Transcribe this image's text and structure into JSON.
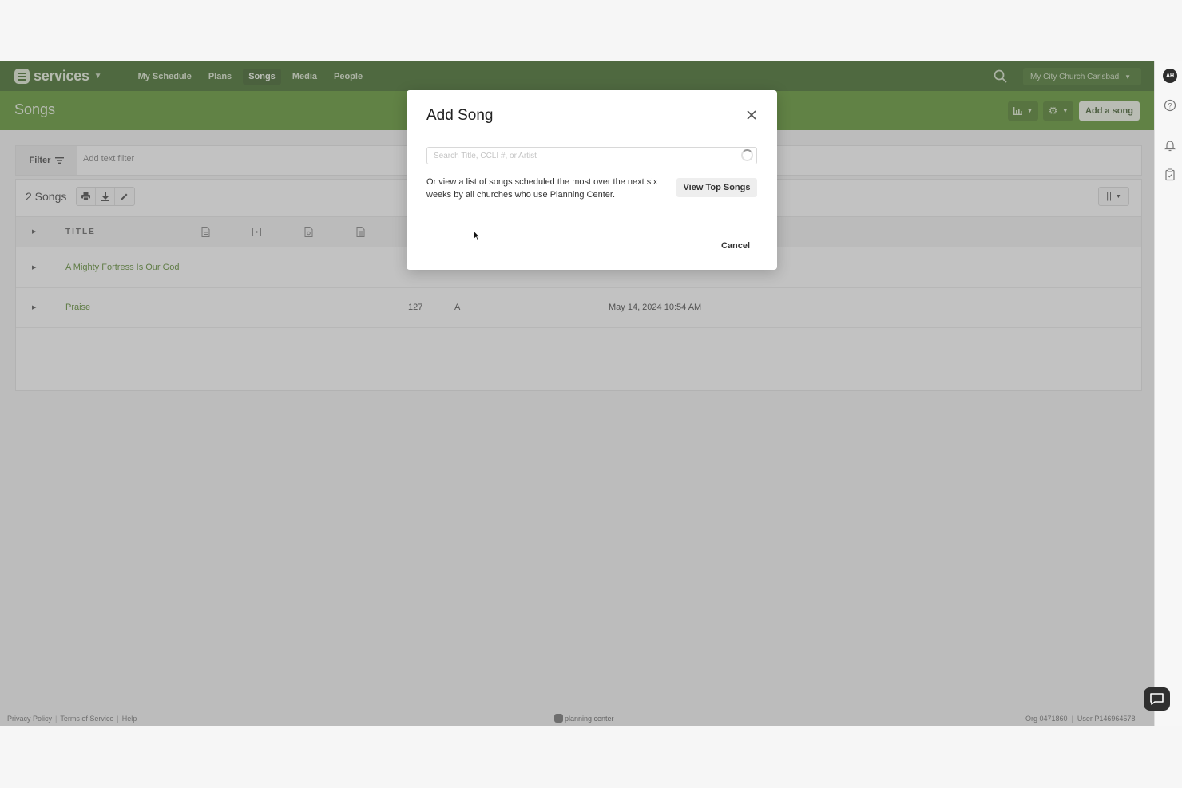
{
  "nav": {
    "brand": "services",
    "links": [
      "My Schedule",
      "Plans",
      "Songs",
      "Media",
      "People"
    ],
    "active_link": "Songs",
    "org": "My City Church Carlsbad"
  },
  "user": {
    "initials": "AH"
  },
  "page": {
    "title": "Songs",
    "add_button": "Add a song"
  },
  "filter": {
    "label": "Filter",
    "placeholder": "Add text filter"
  },
  "table": {
    "count": "2 Songs",
    "header_title": "TITLE",
    "rows": [
      {
        "title": "A Mighty Fortress Is Our God",
        "ccli": "",
        "key": "",
        "updated": ""
      },
      {
        "title": "Praise",
        "ccli": "127",
        "key": "A",
        "updated": "May 14, 2024 10:54 AM"
      }
    ]
  },
  "modal": {
    "title": "Add Song",
    "search_placeholder": "Search Title, CCLI #, or Artist",
    "description": "Or view a list of songs scheduled the most over the next six weeks by all churches who use Planning Center.",
    "top_songs_button": "View Top Songs",
    "cancel_button": "Cancel"
  },
  "footer": {
    "privacy": "Privacy Policy",
    "terms": "Terms of Service",
    "help": "Help",
    "brand": "planning center",
    "org_id": "Org 0471860",
    "user_id": "User P146964578"
  },
  "colors": {
    "nav_bg": "#2f5d13",
    "header_bg": "#4f8a1d",
    "link_green": "#4b7f1c"
  }
}
